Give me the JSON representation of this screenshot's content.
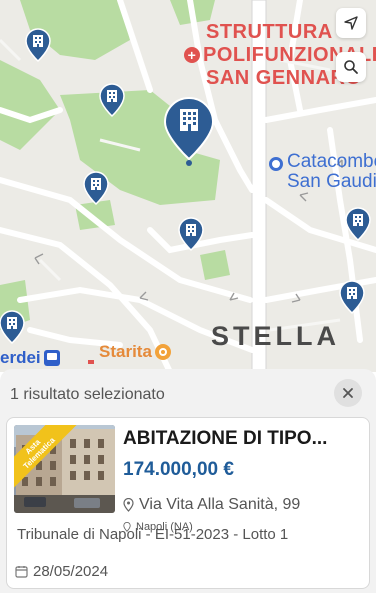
{
  "map": {
    "labels": {
      "poi_line1": "STRUTTURA",
      "poi_line2": "POLIFUNZIONALE",
      "poi_line3": "SAN GENNARO",
      "catacomb_line1": "Catacombe di",
      "catacomb_line2": "San Gaudioso",
      "district": "STELLA",
      "restaurant": "Starita",
      "station": "erdei"
    },
    "controls": {
      "locate_icon": "location-arrow-icon",
      "search_icon": "search-icon"
    },
    "marker_icon": "building-icon"
  },
  "results": {
    "header": "1 risultato selezionato",
    "close_icon": "close-icon",
    "item": {
      "ribbon_line1": "Asta",
      "ribbon_line2": "Telematica",
      "title": "ABITAZIONE DI TIPO...",
      "price": "174.000,00 €",
      "address": "Via Vita Alla Sanità, 99",
      "city": "Napoli (NA)",
      "court": "Tribunale di Napoli - EI-51-2023 - Lotto 1",
      "date": "28/05/2024"
    }
  },
  "colors": {
    "accent_blue": "#1f5c99",
    "marker_blue": "#2d5c94",
    "poi_red": "#e0524f",
    "ribbon_yellow": "#f1c21b"
  }
}
